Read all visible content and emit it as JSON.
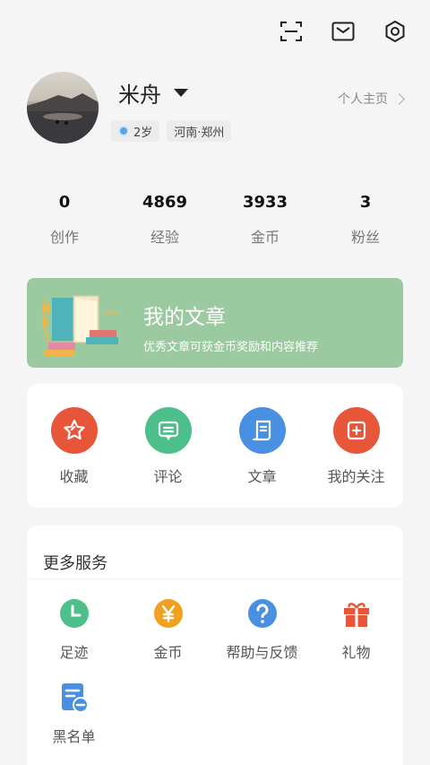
{
  "profile": {
    "name": "米舟",
    "age_tag": "2岁",
    "location_tag": "河南·郑州",
    "home_link": "个人主页"
  },
  "stats": [
    {
      "value": "0",
      "label": "创作"
    },
    {
      "value": "4869",
      "label": "经验"
    },
    {
      "value": "3933",
      "label": "金币"
    },
    {
      "value": "3",
      "label": "粉丝"
    }
  ],
  "banner": {
    "title": "我的文章",
    "subtitle": "优秀文章可获金币奖励和内容推荐"
  },
  "quick": [
    {
      "label": "收藏",
      "icon": "star-icon",
      "color": "#e8563a"
    },
    {
      "label": "评论",
      "icon": "comment-icon",
      "color": "#4cbf8b"
    },
    {
      "label": "文章",
      "icon": "article-icon",
      "color": "#4a90e2"
    },
    {
      "label": "我的关注",
      "icon": "follow-icon",
      "color": "#e8563a"
    }
  ],
  "more": {
    "title": "更多服务",
    "items": [
      {
        "label": "足迹",
        "icon": "clock-icon",
        "color": "#4cbf8b"
      },
      {
        "label": "金币",
        "icon": "coin-icon",
        "color": "#f1a01f"
      },
      {
        "label": "帮助与反馈",
        "icon": "help-icon",
        "color": "#4a90e2"
      },
      {
        "label": "礼物",
        "icon": "gift-icon",
        "color": "#e8563a"
      },
      {
        "label": "黑名单",
        "icon": "blacklist-icon",
        "color": "#4a90e2"
      }
    ]
  }
}
